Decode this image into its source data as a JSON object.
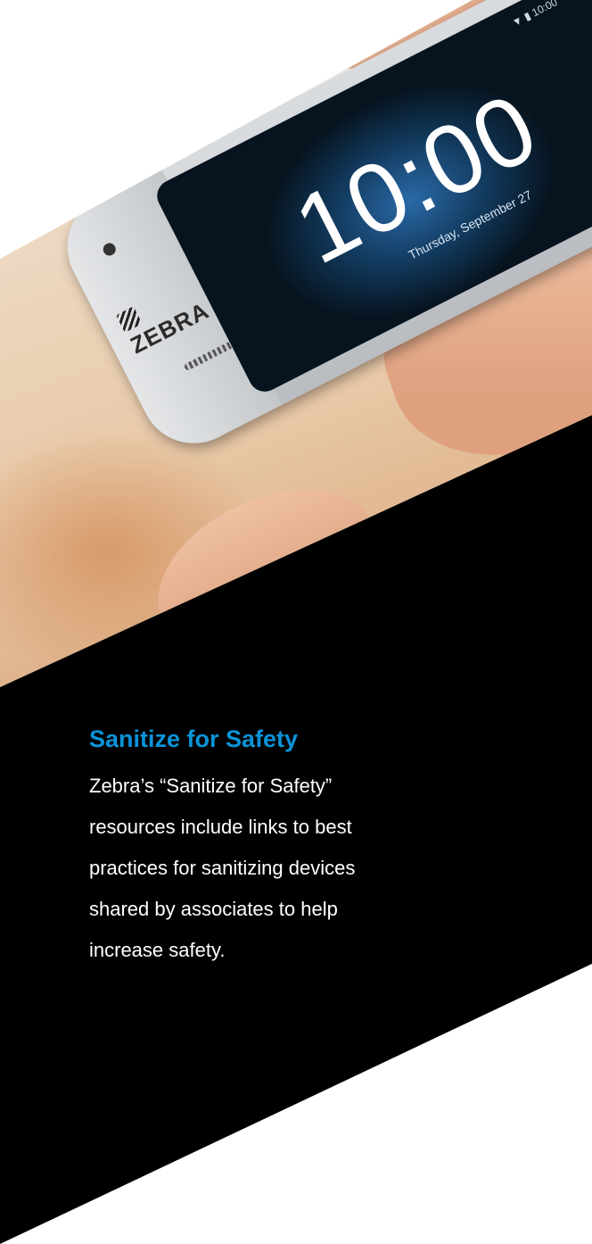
{
  "hero_image": {
    "device": {
      "brand": "ZEBRA",
      "clock_time": "10:00",
      "clock_date": "Thursday, September 27",
      "status": "▼ ▮ 10:00"
    }
  },
  "content": {
    "heading": "Sanitize for Safety",
    "body_lines": [
      "Zebra’s “Sanitize for Safety”",
      "resources include links to best",
      "practices for sanitizing devices",
      "shared by associates to help",
      "increase safety."
    ]
  },
  "colors": {
    "heading": "#0a93d8",
    "band": "#000000",
    "body_text": "#ffffff"
  }
}
